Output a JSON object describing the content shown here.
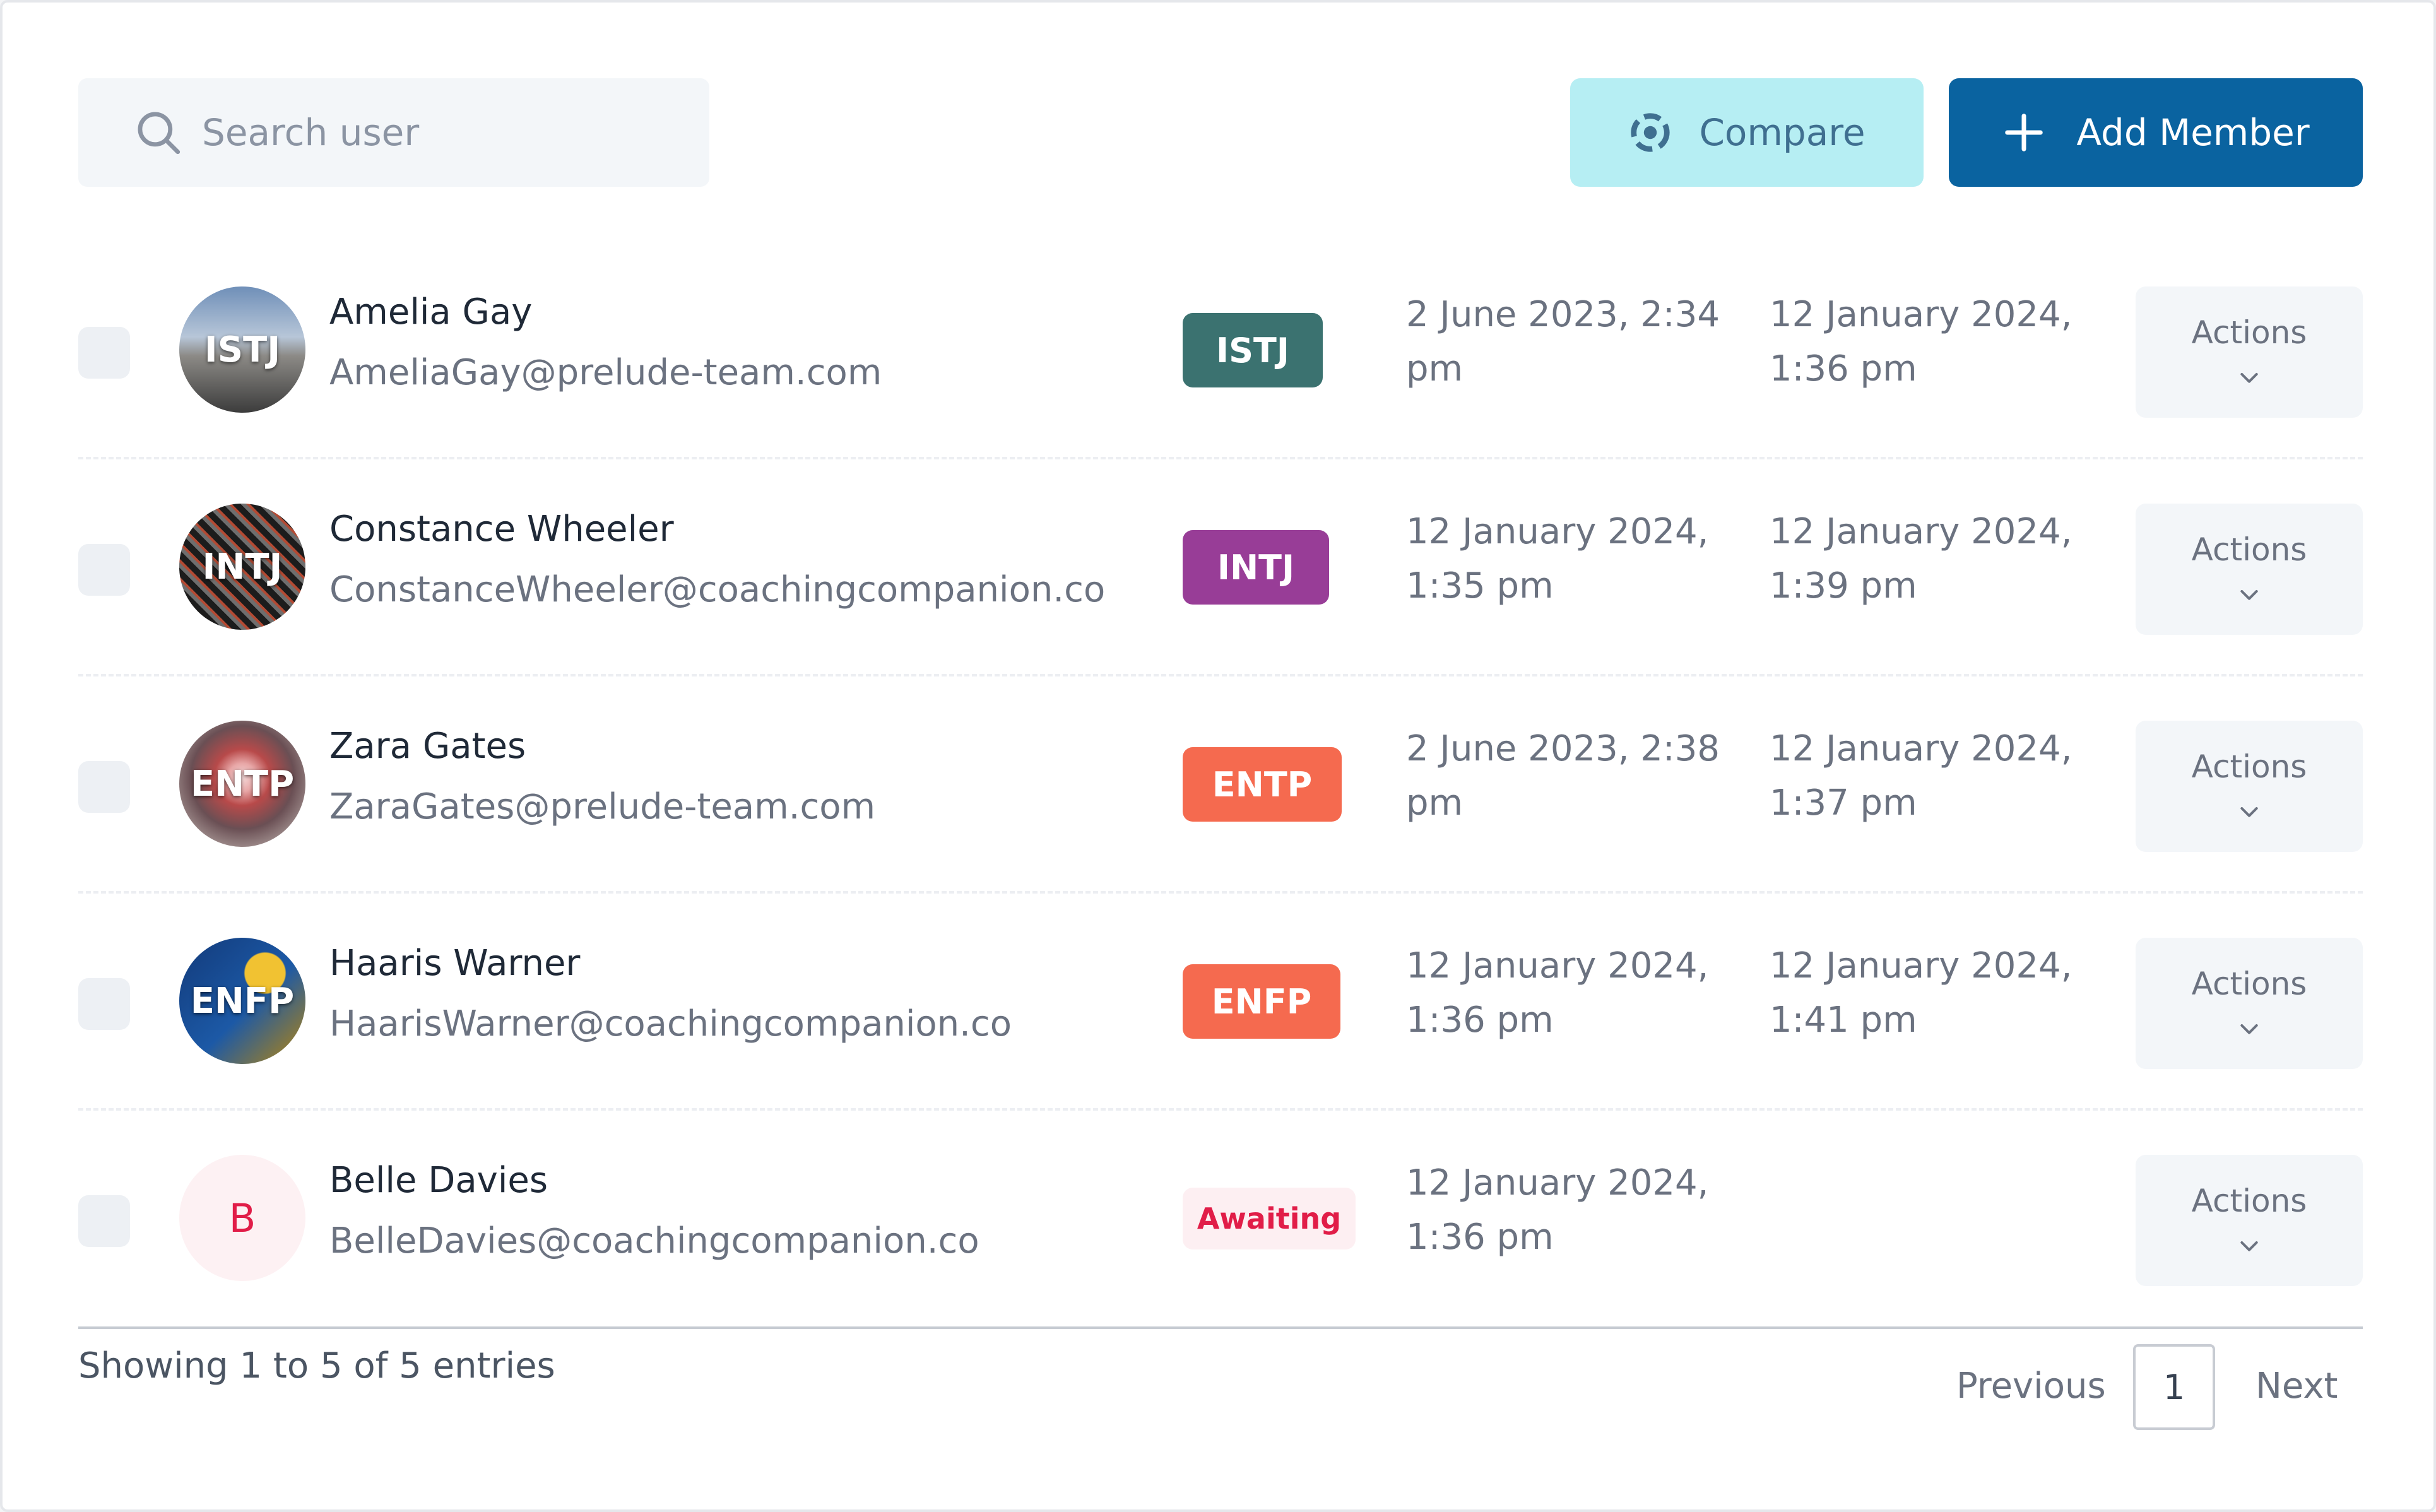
{
  "toolbar": {
    "search_placeholder": "Search user",
    "compare_label": "Compare",
    "add_member_label": "Add Member"
  },
  "rows": [
    {
      "avatar_text": "ISTJ",
      "name": "Amelia Gay",
      "email": "AmeliaGay@prelude-team.com",
      "badge": "ISTJ",
      "created_line1": "2 June 2023, 2:34",
      "created_line2": "pm",
      "updated_line1": "12 January 2024,",
      "updated_line2": "1:36 pm",
      "actions_label": "Actions"
    },
    {
      "avatar_text": "INTJ",
      "name": "Constance Wheeler",
      "email": "ConstanceWheeler@coachingcompanion.co",
      "badge": "INTJ",
      "created_line1": "12 January 2024,",
      "created_line2": "1:35 pm",
      "updated_line1": "12 January 2024,",
      "updated_line2": "1:39 pm",
      "actions_label": "Actions"
    },
    {
      "avatar_text": "ENTP",
      "name": "Zara Gates",
      "email": "ZaraGates@prelude-team.com",
      "badge": "ENTP",
      "created_line1": "2 June 2023, 2:38",
      "created_line2": "pm",
      "updated_line1": "12 January 2024,",
      "updated_line2": "1:37 pm",
      "actions_label": "Actions"
    },
    {
      "avatar_text": "ENFP",
      "name": "Haaris Warner",
      "email": "HaarisWarner@coachingcompanion.co",
      "badge": "ENFP",
      "created_line1": "12 January 2024,",
      "created_line2": "1:36 pm",
      "updated_line1": "12 January 2024,",
      "updated_line2": "1:41 pm",
      "actions_label": "Actions"
    },
    {
      "avatar_text": "B",
      "name": "Belle Davies",
      "email": "BelleDavies@coachingcompanion.co",
      "badge": "Awaiting",
      "created_line1": "12 January 2024,",
      "created_line2": "1:36 pm",
      "updated_line1": "",
      "updated_line2": "",
      "actions_label": "Actions"
    }
  ],
  "badge_colors": {
    "ISTJ": "#3b7270",
    "INTJ": "#983d97",
    "ENTP": "#f56a4f",
    "ENFP": "#f56a4f",
    "Awaiting": "#fdeff2"
  },
  "footer": {
    "showing": "Showing 1 to 5 of 5 entries",
    "previous": "Previous",
    "page": "1",
    "next": "Next"
  }
}
